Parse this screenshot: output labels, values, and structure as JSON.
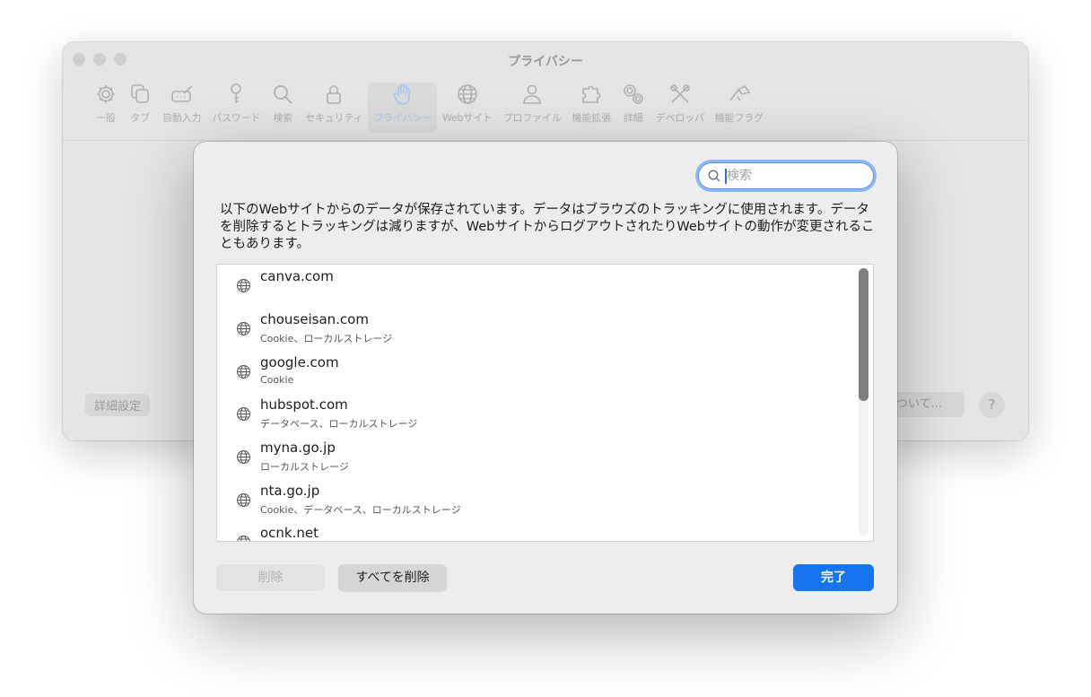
{
  "window": {
    "title": "プライバシー",
    "toolbar": [
      {
        "label": "一般",
        "icon": "gear-icon"
      },
      {
        "label": "タブ",
        "icon": "tabs-icon"
      },
      {
        "label": "自動入力",
        "icon": "pencil-icon"
      },
      {
        "label": "パスワード",
        "icon": "key-icon"
      },
      {
        "label": "検索",
        "icon": "search-icon"
      },
      {
        "label": "セキュリティ",
        "icon": "lock-icon"
      },
      {
        "label": "プライバシー",
        "icon": "hand-icon",
        "selected": true
      },
      {
        "label": "Webサイト",
        "icon": "globe-icon"
      },
      {
        "label": "プロファイル",
        "icon": "person-icon"
      },
      {
        "label": "機能拡張",
        "icon": "puzzle-icon"
      },
      {
        "label": "詳細",
        "icon": "gears-icon"
      },
      {
        "label": "デベロッパ",
        "icon": "tools-icon"
      },
      {
        "label": "機能フラグ",
        "icon": "flags-icon"
      }
    ],
    "advanced_button": "詳細設定",
    "about_button": "ついて...",
    "help_button": "?"
  },
  "sheet": {
    "search": {
      "placeholder": "検索",
      "value": ""
    },
    "description": "以下のWebサイトからのデータが保存されています。データはブラウズのトラッキングに使用されます。データを削除するとトラッキングは減りますが、WebサイトからログアウトされたりWebサイトの動作が変更されることもあります。",
    "sites": [
      {
        "domain": "canva.com",
        "detail": ""
      },
      {
        "domain": "chouseisan.com",
        "detail": "Cookie、ローカルストレージ"
      },
      {
        "domain": "google.com",
        "detail": "Cookie"
      },
      {
        "domain": "hubspot.com",
        "detail": "データベース、ローカルストレージ"
      },
      {
        "domain": "myna.go.jp",
        "detail": "ローカルストレージ"
      },
      {
        "domain": "nta.go.jp",
        "detail": "Cookie、データベース、ローカルストレージ"
      },
      {
        "domain": "ocnk.net",
        "detail": ""
      }
    ],
    "buttons": {
      "delete": "削除",
      "delete_all": "すべてを削除",
      "done": "完了"
    },
    "colors": {
      "accent": "#1674f0",
      "focus_ring": "#8cb7f4"
    }
  }
}
